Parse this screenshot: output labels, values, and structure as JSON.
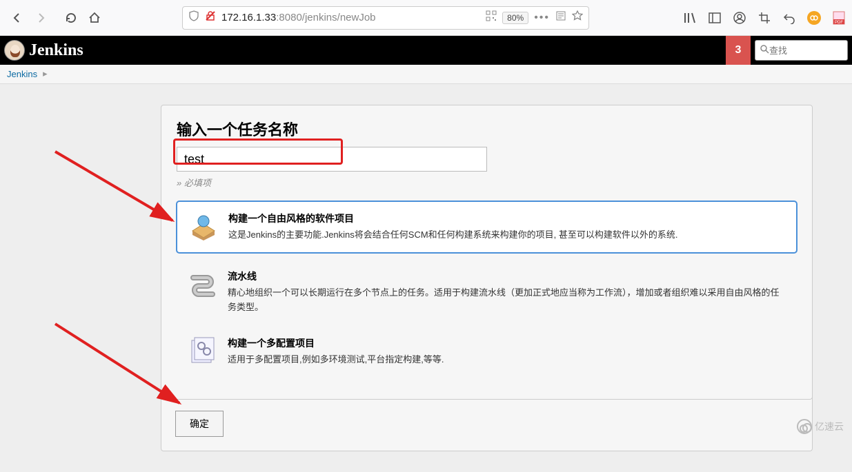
{
  "browser": {
    "url_prefix": "172.16.1.33",
    "url_suffix": ":8080/jenkins/newJob",
    "zoom": "80%"
  },
  "header": {
    "brand": "Jenkins",
    "notifications": "3",
    "search_placeholder": "查找"
  },
  "breadcrumb": {
    "root": "Jenkins"
  },
  "form": {
    "heading": "输入一个任务名称",
    "name_value": "test",
    "required_note": "» 必填项"
  },
  "job_types": [
    {
      "title": "构建一个自由风格的软件项目",
      "desc": "这是Jenkins的主要功能.Jenkins将会结合任何SCM和任何构建系统来构建你的项目, 甚至可以构建软件以外的系统.",
      "selected": true
    },
    {
      "title": "流水线",
      "desc": "精心地组织一个可以长期运行在多个节点上的任务。适用于构建流水线（更加正式地应当称为工作流），增加或者组织难以采用自由风格的任务类型。",
      "selected": false
    },
    {
      "title": "构建一个多配置项目",
      "desc": "适用于多配置项目,例如多环境测试,平台指定构建,等等.",
      "selected": false
    }
  ],
  "buttons": {
    "ok": "确定"
  },
  "watermark": "亿速云"
}
